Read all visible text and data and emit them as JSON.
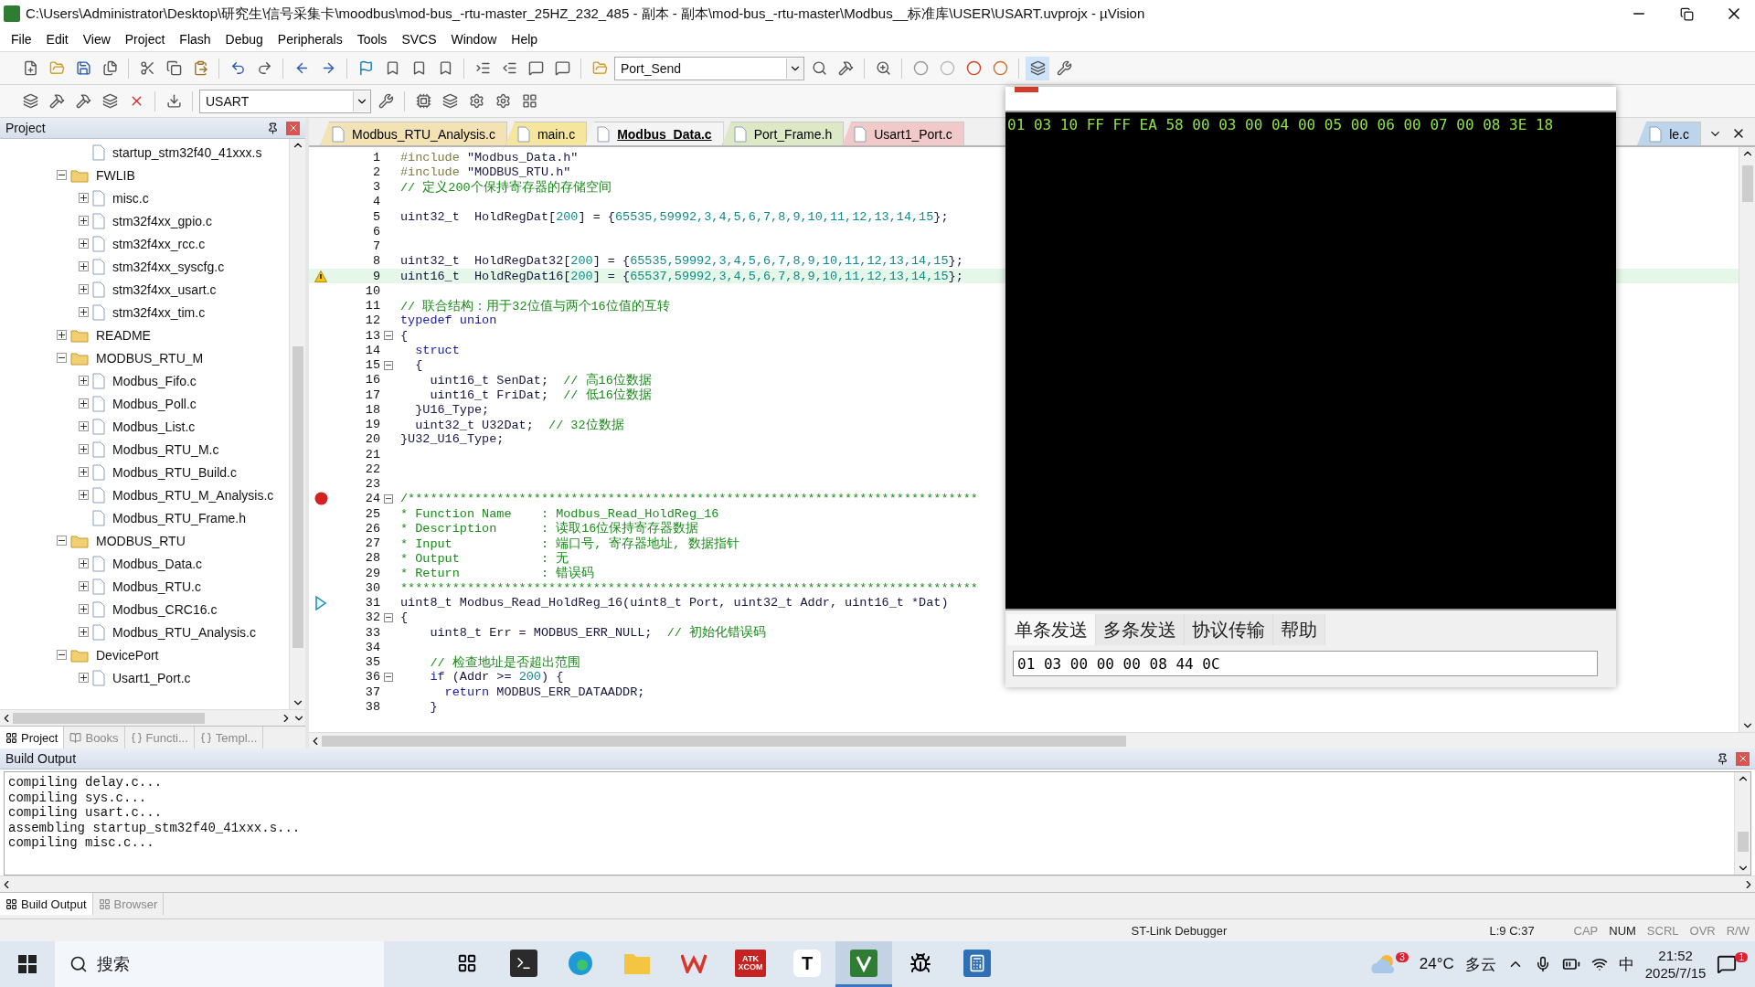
{
  "window": {
    "title": "C:\\Users\\Administrator\\Desktop\\研究生\\信号采集卡\\moodbus\\mod-bus_-rtu-master_25HZ_232_485 - 副本 - 副本\\mod-bus_-rtu-master\\Modbus__标准库\\USER\\USART.uvprojx - µVision"
  },
  "menu": [
    "File",
    "Edit",
    "View",
    "Project",
    "Flash",
    "Debug",
    "Peripherals",
    "Tools",
    "SVCS",
    "Window",
    "Help"
  ],
  "toolbar": {
    "find_dropdown": "Port_Send",
    "target_dropdown": "USART"
  },
  "project_panel": {
    "title": "Project",
    "tree": [
      {
        "label": "startup_stm32f40_41xxx.s",
        "kind": "file"
      },
      {
        "label": "FWLIB",
        "kind": "folder",
        "expanded": true,
        "children": [
          {
            "label": "misc.c",
            "kind": "file",
            "expandable": true
          },
          {
            "label": "stm32f4xx_gpio.c",
            "kind": "file",
            "expandable": true
          },
          {
            "label": "stm32f4xx_rcc.c",
            "kind": "file",
            "expandable": true
          },
          {
            "label": "stm32f4xx_syscfg.c",
            "kind": "file",
            "expandable": true
          },
          {
            "label": "stm32f4xx_usart.c",
            "kind": "file",
            "expandable": true
          },
          {
            "label": "stm32f4xx_tim.c",
            "kind": "file",
            "expandable": true
          }
        ]
      },
      {
        "label": "README",
        "kind": "folder",
        "expanded": false
      },
      {
        "label": "MODBUS_RTU_M",
        "kind": "folder",
        "expanded": true,
        "children": [
          {
            "label": "Modbus_Fifo.c",
            "kind": "file",
            "expandable": true
          },
          {
            "label": "Modbus_Poll.c",
            "kind": "file",
            "expandable": true
          },
          {
            "label": "Modbus_List.c",
            "kind": "file",
            "expandable": true
          },
          {
            "label": "Modbus_RTU_M.c",
            "kind": "file",
            "expandable": true
          },
          {
            "label": "Modbus_RTU_Build.c",
            "kind": "file",
            "expandable": true
          },
          {
            "label": "Modbus_RTU_M_Analysis.c",
            "kind": "file",
            "expandable": true
          },
          {
            "label": "Modbus_RTU_Frame.h",
            "kind": "file"
          }
        ]
      },
      {
        "label": "MODBUS_RTU",
        "kind": "folder",
        "expanded": true,
        "children": [
          {
            "label": "Modbus_Data.c",
            "kind": "file",
            "expandable": true
          },
          {
            "label": "Modbus_RTU.c",
            "kind": "file",
            "expandable": true
          },
          {
            "label": "Modbus_CRC16.c",
            "kind": "file",
            "expandable": true
          },
          {
            "label": "Modbus_RTU_Analysis.c",
            "kind": "file",
            "expandable": true
          }
        ]
      },
      {
        "label": "DevicePort",
        "kind": "folder",
        "expanded": true,
        "children": [
          {
            "label": "Usart1_Port.c",
            "kind": "file",
            "expandable": true
          }
        ]
      }
    ],
    "tabs": [
      {
        "label": "Project",
        "kind": "project",
        "selected": true
      },
      {
        "label": "Books",
        "kind": "books",
        "selected": false
      },
      {
        "label": "Functi...",
        "kind": "functions",
        "selected": false
      },
      {
        "label": "Templ...",
        "kind": "templates",
        "selected": false
      }
    ]
  },
  "editor": {
    "tabs": [
      {
        "label": "Modbus_RTU_Analysis.c",
        "selected": false,
        "color": "#f3e2b3"
      },
      {
        "label": "main.c",
        "selected": false,
        "color": "#f6e59c"
      },
      {
        "label": "Modbus_Data.c",
        "selected": true,
        "color": "#f4f4f4"
      },
      {
        "label": "Port_Frame.h",
        "selected": false,
        "color": "#dde8c6"
      },
      {
        "label": "Usart1_Port.c",
        "selected": false,
        "color": "#f2c9c9"
      },
      {
        "label": "le.c",
        "selected": false,
        "color": "#bcd4ec"
      }
    ],
    "lines": [
      {
        "number": "1",
        "segments": [
          {
            "kind": "pre",
            "text": "#include "
          },
          {
            "kind": "plain",
            "text": "\"Modbus_Data.h\""
          }
        ]
      },
      {
        "number": "2",
        "segments": [
          {
            "kind": "pre",
            "text": "#include "
          },
          {
            "kind": "plain",
            "text": "\"MODBUS_RTU.h\""
          }
        ]
      },
      {
        "number": "3",
        "segments": [
          {
            "kind": "comment",
            "text": "// 定义200个保持寄存器的存储空间"
          }
        ]
      },
      {
        "number": "4"
      },
      {
        "number": "5",
        "segments": [
          {
            "kind": "plain",
            "text": "uint32_t  HoldRegDat["
          },
          {
            "kind": "num",
            "text": "200"
          },
          {
            "kind": "plain",
            "text": "] = {"
          },
          {
            "kind": "num",
            "text": "65535,59992,3,4,5,6,7,8,9,10,11,12,13,14,15"
          },
          {
            "kind": "plain",
            "text": "};"
          }
        ]
      },
      {
        "number": "6"
      },
      {
        "number": "7"
      },
      {
        "number": "8",
        "segments": [
          {
            "kind": "plain",
            "text": "uint32_t  HoldRegDat32["
          },
          {
            "kind": "num",
            "text": "200"
          },
          {
            "kind": "plain",
            "text": "] = {"
          },
          {
            "kind": "num",
            "text": "65535,59992,3,4,5,6,7,8,9,10,11,12,13,14,15"
          },
          {
            "kind": "plain",
            "text": "};"
          }
        ]
      },
      {
        "number": "9",
        "warning": true,
        "highlighted": true,
        "segments": [
          {
            "kind": "plain",
            "text": "uint16_t  HoldRegDat16["
          },
          {
            "kind": "num",
            "text": "200"
          },
          {
            "kind": "plain",
            "text": "] = {"
          },
          {
            "kind": "num",
            "text": "65537,59992,3,4,5,6,7,8,9,10,11,12,13,14,15"
          },
          {
            "kind": "plain",
            "text": "};"
          }
        ]
      },
      {
        "number": "10"
      },
      {
        "number": "11",
        "segments": [
          {
            "kind": "comment",
            "text": "// 联合结构：用于32位值与两个16位值的互转"
          }
        ]
      },
      {
        "number": "12",
        "segments": [
          {
            "kind": "keyword",
            "text": "typedef union"
          }
        ]
      },
      {
        "number": "13",
        "fold": true,
        "segments": [
          {
            "kind": "plain",
            "text": "{"
          }
        ]
      },
      {
        "number": "14",
        "segments": [
          {
            "kind": "keyword",
            "text": "  struct"
          }
        ]
      },
      {
        "number": "15",
        "fold": true,
        "segments": [
          {
            "kind": "plain",
            "text": "  {"
          }
        ]
      },
      {
        "number": "16",
        "segments": [
          {
            "kind": "plain",
            "text": "    uint16_t SenDat;  "
          },
          {
            "kind": "comment",
            "text": "// 高16位数据"
          }
        ]
      },
      {
        "number": "17",
        "segments": [
          {
            "kind": "plain",
            "text": "    uint16_t FriDat;  "
          },
          {
            "kind": "comment",
            "text": "// 低16位数据"
          }
        ]
      },
      {
        "number": "18",
        "segments": [
          {
            "kind": "plain",
            "text": "  }U16_Type;"
          }
        ]
      },
      {
        "number": "19",
        "segments": [
          {
            "kind": "plain",
            "text": "  uint32_t U32Dat;  "
          },
          {
            "kind": "comment",
            "text": "// 32位数据"
          }
        ]
      },
      {
        "number": "20",
        "segments": [
          {
            "kind": "plain",
            "text": "}U32_U16_Type;"
          }
        ]
      },
      {
        "number": "21"
      },
      {
        "number": "22"
      },
      {
        "number": "23"
      },
      {
        "number": "24",
        "breakpoint": true,
        "fold": true,
        "segments": [
          {
            "kind": "comment",
            "text": "/*****************************************************************************"
          }
        ]
      },
      {
        "number": "25",
        "segments": [
          {
            "kind": "comment",
            "text": "* Function Name    : Modbus_Read_HoldReg_16"
          }
        ]
      },
      {
        "number": "26",
        "segments": [
          {
            "kind": "comment",
            "text": "* Description      : 读取16位保持寄存器数据"
          }
        ]
      },
      {
        "number": "27",
        "segments": [
          {
            "kind": "comment",
            "text": "* Input            : 端口号, 寄存器地址, 数据指针"
          }
        ]
      },
      {
        "number": "28",
        "segments": [
          {
            "kind": "comment",
            "text": "* Output           : 无"
          }
        ]
      },
      {
        "number": "29",
        "segments": [
          {
            "kind": "comment",
            "text": "* Return           : 错误码"
          }
        ]
      },
      {
        "number": "30",
        "segments": [
          {
            "kind": "comment",
            "text": "******************************************************************************"
          }
        ]
      },
      {
        "number": "31",
        "current": true,
        "segments": [
          {
            "kind": "plain",
            "text": "uint8_t Modbus_Read_HoldReg_16(uint8_t Port, uint32_t Addr, uint16_t *Dat)"
          }
        ]
      },
      {
        "number": "32",
        "fold": true,
        "segments": [
          {
            "kind": "plain",
            "text": "{"
          }
        ]
      },
      {
        "number": "33",
        "segments": [
          {
            "kind": "plain",
            "text": "    uint8_t Err = MODBUS_ERR_NULL;  "
          },
          {
            "kind": "comment",
            "text": "// 初始化错误码"
          }
        ]
      },
      {
        "number": "34"
      },
      {
        "number": "35",
        "segments": [
          {
            "kind": "comment",
            "text": "    // 检查地址是否超出范围"
          }
        ]
      },
      {
        "number": "36",
        "fold": true,
        "segments": [
          {
            "kind": "keyword",
            "text": "    if"
          },
          {
            "kind": "plain",
            "text": " (Addr >= "
          },
          {
            "kind": "num",
            "text": "200"
          },
          {
            "kind": "plain",
            "text": ") {"
          }
        ]
      },
      {
        "number": "37",
        "segments": [
          {
            "kind": "keyword",
            "text": "      return"
          },
          {
            "kind": "plain",
            "text": " MODBUS_ERR_DATAADDR;"
          }
        ]
      },
      {
        "number": "38",
        "segments": [
          {
            "kind": "plain",
            "text": "    }"
          }
        ]
      }
    ]
  },
  "xcom": {
    "receive_text": "01 03 10 FF FF EA 58 00 03 00 04 00 05 00 06 00 07 00 08 3E 18",
    "tabs": [
      {
        "label": "单条发送",
        "selected": true
      },
      {
        "label": "多条发送",
        "selected": false
      },
      {
        "label": "协议传输",
        "selected": false
      },
      {
        "label": "帮助",
        "selected": false
      }
    ],
    "send_value": "01 03 00 00 00 08 44 0C"
  },
  "build_output": {
    "title": "Build Output",
    "lines": [
      "compiling delay.c...",
      "compiling sys.c...",
      "compiling usart.c...",
      "assembling startup_stm32f40_41xxx.s...",
      "compiling misc.c..."
    ],
    "tabs": [
      {
        "label": "Build Output",
        "selected": true
      },
      {
        "label": "Browser",
        "selected": false
      }
    ]
  },
  "status_bar": {
    "debugger": "ST-Link Debugger",
    "position": "L:9 C:37",
    "indicators": [
      {
        "label": "CAP",
        "on": false
      },
      {
        "label": "NUM",
        "on": true
      },
      {
        "label": "SCRL",
        "on": false
      },
      {
        "label": "OVR",
        "on": false
      },
      {
        "label": "R/W",
        "on": false
      }
    ]
  },
  "taskbar": {
    "search_placeholder": "搜索",
    "apps": [
      {
        "kind": "taskview",
        "active": false
      },
      {
        "kind": "terminal",
        "active": false
      },
      {
        "kind": "edge",
        "active": false
      },
      {
        "kind": "explorer",
        "active": false
      },
      {
        "kind": "wps",
        "active": false
      },
      {
        "kind": "xcom",
        "lines": [
          "ATK",
          "XCOM"
        ],
        "active": false
      },
      {
        "kind": "typora",
        "label": "T",
        "active": false
      },
      {
        "kind": "keil",
        "active": true
      },
      {
        "kind": "debugger",
        "active": false
      },
      {
        "kind": "calculator",
        "active": false
      }
    ],
    "weather_badge": "3",
    "temperature": "24°C",
    "weather": "多云",
    "ime": "中",
    "time": "21:52",
    "date": "2025/7/15",
    "notifications": "1"
  }
}
